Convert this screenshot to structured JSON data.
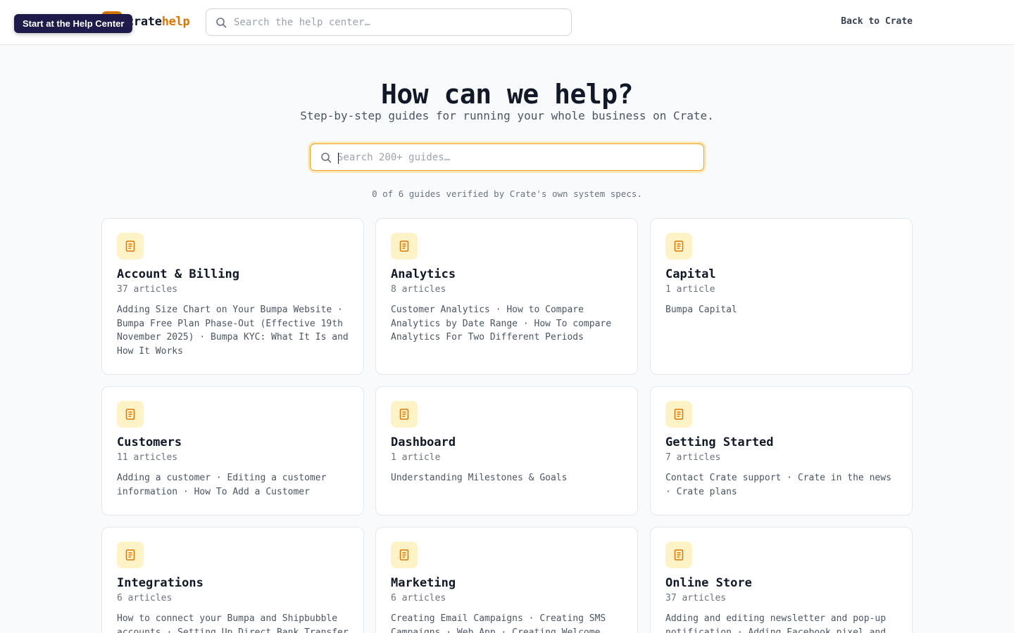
{
  "tooltip": {
    "text": "Start at the Help Center"
  },
  "logo": {
    "brand": "crate",
    "suffix": "help"
  },
  "header": {
    "search_placeholder": "Search the help center…",
    "back_label": "Back to Crate"
  },
  "hero": {
    "title": "How can we help?",
    "subtitle": "Step-by-step guides for running your whole business on Crate.",
    "search_placeholder": "Search 200+ guides…",
    "verify_note": "0 of 6 guides verified by Crate's own system specs."
  },
  "colors": {
    "accent": "#d97706",
    "accent_soft": "#fef3c7",
    "tooltip_bg": "#1e1b4b"
  },
  "categories": [
    {
      "title": "Account & Billing",
      "count": "37 articles",
      "desc": "Adding Size Chart on Your Bumpa Website · Bumpa Free Plan Phase-Out (Effective 19th November 2025) · Bumpa KYC: What It Is and How It Works",
      "icon": "document-icon"
    },
    {
      "title": "Analytics",
      "count": "8 articles",
      "desc": "Customer Analytics · How to Compare Analytics by Date Range · How To compare Analytics For Two Different Periods",
      "icon": "document-icon"
    },
    {
      "title": "Capital",
      "count": "1 article",
      "desc": "Bumpa Capital",
      "icon": "document-icon"
    },
    {
      "title": "Customers",
      "count": "11 articles",
      "desc": "Adding a customer · Editing a customer information · How To Add a Customer",
      "icon": "document-icon"
    },
    {
      "title": "Dashboard",
      "count": "1 article",
      "desc": "Understanding Milestones & Goals",
      "icon": "document-icon"
    },
    {
      "title": "Getting Started",
      "count": "7 articles",
      "desc": "Contact Crate support · Crate in the news · Crate plans",
      "icon": "document-icon"
    },
    {
      "title": "Integrations",
      "count": "6 articles",
      "desc": "How to connect your Bumpa and Shipbubble accounts · Setting Up Direct Bank Transfer",
      "icon": "document-icon"
    },
    {
      "title": "Marketing",
      "count": "6 articles",
      "desc": "Creating Email Campaigns · Creating SMS Campaigns · Web App · Creating Welcome",
      "icon": "document-icon"
    },
    {
      "title": "Online Store",
      "count": "37 articles",
      "desc": "Adding and editing newsletter and pop-up notification · Adding Facebook pixel and",
      "icon": "document-icon"
    }
  ]
}
